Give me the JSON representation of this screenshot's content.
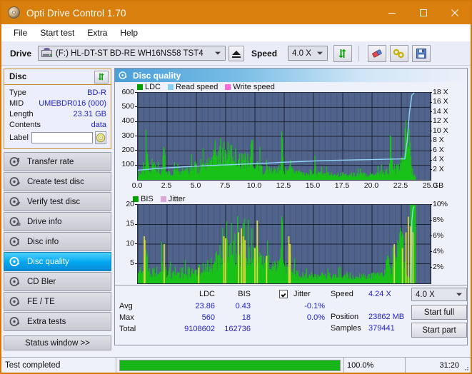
{
  "window": {
    "title": "Opti Drive Control 1.70",
    "icon": "disc-icon",
    "minimize": "minimize-icon",
    "maximize": "maximize-icon",
    "close": "close-icon",
    "accent": "#d97f0d"
  },
  "menu": {
    "items": [
      {
        "label": "File"
      },
      {
        "label": "Start test"
      },
      {
        "label": "Extra"
      },
      {
        "label": "Help"
      }
    ]
  },
  "toolbar": {
    "drive_label": "Drive",
    "drive_value": "(F:)  HL-DT-ST BD-RE  WH16NS58 TST4",
    "eject": "eject-icon",
    "speed_label": "Speed",
    "speed_value": "4.0 X",
    "refresh": "refresh-icon",
    "erase": "eraser-icon",
    "tools": "tools-icon",
    "save": "save-icon"
  },
  "disc_panel": {
    "title": "Disc",
    "refresh": "refresh-icon",
    "rows": [
      {
        "key": "Type",
        "value": "BD-R"
      },
      {
        "key": "MID",
        "value": "UMEBDR016 (000)"
      },
      {
        "key": "Length",
        "value": "23.31 GB"
      },
      {
        "key": "Contents",
        "value": "data"
      }
    ],
    "label_key": "Label",
    "label_value": "",
    "label_placeholder": "",
    "disc_button": "disc-icon"
  },
  "nav": {
    "items": [
      {
        "label": "Transfer rate",
        "icon": "disc-speed-icon",
        "active": false
      },
      {
        "label": "Create test disc",
        "icon": "disc-write-icon",
        "active": false
      },
      {
        "label": "Verify test disc",
        "icon": "disc-verify-icon",
        "active": false
      },
      {
        "label": "Drive info",
        "icon": "drive-info-icon",
        "active": false
      },
      {
        "label": "Disc info",
        "icon": "disc-info-icon",
        "active": false
      },
      {
        "label": "Disc quality",
        "icon": "disc-quality-icon",
        "active": true
      },
      {
        "label": "CD Bler",
        "icon": "disc-bler-icon",
        "active": false
      },
      {
        "label": "FE / TE",
        "icon": "disc-fete-icon",
        "active": false
      },
      {
        "label": "Extra tests",
        "icon": "disc-extra-icon",
        "active": false
      }
    ],
    "status_window": "Status window >>"
  },
  "pane": {
    "title": "Disc quality",
    "icon": "disc-quality-icon"
  },
  "chart_data": [
    {
      "id": "ldc-chart",
      "type": "area",
      "title": "",
      "xlabel": "GB",
      "ylabel": "",
      "xlim": [
        0,
        25
      ],
      "xticks": [
        "0.0",
        "2.5",
        "5.0",
        "7.5",
        "10.0",
        "12.5",
        "15.0",
        "17.5",
        "20.0",
        "22.5",
        "25.0"
      ],
      "xtick_values": [
        0,
        2.5,
        5,
        7.5,
        10,
        12.5,
        15,
        17.5,
        20,
        22.5,
        25
      ],
      "ylim": [
        0,
        600
      ],
      "yticks": [
        "100",
        "200",
        "300",
        "400",
        "500",
        "600"
      ],
      "ytick_values": [
        100,
        200,
        300,
        400,
        500,
        600
      ],
      "y2lim": [
        0,
        18
      ],
      "y2ticks": [
        "2 X",
        "4 X",
        "6 X",
        "8 X",
        "10 X",
        "12 X",
        "14 X",
        "16 X",
        "18 X"
      ],
      "y2tick_values": [
        2,
        4,
        6,
        8,
        10,
        12,
        14,
        16,
        18
      ],
      "grid": true,
      "legend_position": "top-left",
      "legend": [
        {
          "name": "LDC",
          "color": "#00a000"
        },
        {
          "name": "Read speed",
          "color": "#86d2f4"
        },
        {
          "name": "Write speed",
          "color": "#ff66d9"
        }
      ],
      "series": [
        {
          "name": "LDC",
          "color": "#19c219",
          "type": "area",
          "x": [
            0.0,
            0.15,
            0.3,
            0.45,
            0.6,
            0.75,
            0.9,
            1.05,
            1.2,
            1.35,
            1.5,
            1.65,
            1.8,
            1.95,
            2.1,
            2.25,
            2.4,
            2.55,
            2.7,
            2.85,
            3.0,
            3.15,
            3.3,
            3.45,
            3.6,
            3.75,
            3.9,
            4.05,
            4.2,
            4.35,
            4.5,
            4.65,
            4.8,
            4.95,
            5.1,
            5.25,
            5.4,
            5.55,
            5.7,
            5.85,
            6.0,
            6.15,
            6.3,
            6.45,
            6.6,
            6.75,
            6.9,
            7.05,
            7.2,
            7.35,
            7.5,
            7.65,
            7.8,
            7.95,
            8.1,
            8.25,
            8.4,
            8.55,
            8.7,
            8.85,
            9.0,
            9.15,
            9.3,
            9.45,
            9.6,
            9.75,
            9.9,
            10.05,
            10.2,
            10.35,
            10.5,
            10.65,
            10.8,
            10.95,
            11.1,
            11.25,
            11.4,
            11.55,
            11.7,
            11.85,
            12.0,
            12.15,
            12.3,
            12.45,
            12.6,
            12.75,
            12.9,
            13.05,
            13.2,
            13.35,
            13.5,
            13.65,
            13.8,
            13.95,
            14.1,
            14.25,
            14.4,
            14.55,
            14.7,
            14.85,
            15.0,
            15.15,
            15.3,
            15.45,
            15.6,
            15.75,
            15.9,
            16.05,
            16.2,
            16.35,
            16.5,
            16.65,
            16.8,
            16.95,
            17.1,
            17.25,
            17.4,
            17.55,
            17.7,
            17.85,
            18.0,
            18.15,
            18.3,
            18.45,
            18.6,
            18.75,
            18.9,
            19.05,
            19.2,
            19.35,
            19.5,
            19.65,
            19.8,
            19.95,
            20.1,
            20.25,
            20.4,
            20.55,
            20.7,
            20.85,
            21.0,
            21.15,
            21.3,
            21.45,
            21.6,
            21.75,
            21.9,
            22.05,
            22.2,
            22.35,
            22.5,
            22.65,
            22.8,
            22.95,
            23.1,
            23.25,
            23.4,
            23.55,
            23.7
          ],
          "values": [
            55,
            80,
            60,
            160,
            95,
            560,
            120,
            70,
            90,
            160,
            70,
            60,
            100,
            55,
            60,
            450,
            75,
            60,
            90,
            65,
            60,
            180,
            70,
            140,
            60,
            170,
            60,
            100,
            95,
            60,
            130,
            110,
            80,
            190,
            70,
            110,
            95,
            150,
            90,
            170,
            120,
            200,
            155,
            230,
            180,
            260,
            200,
            300,
            250,
            310,
            240,
            290,
            220,
            280,
            250,
            260,
            215,
            240,
            190,
            230,
            185,
            225,
            175,
            200,
            160,
            430,
            150,
            175,
            145,
            170,
            140,
            90,
            95,
            80,
            115,
            90,
            100,
            85,
            105,
            90,
            110,
            95,
            410,
            120,
            90,
            100,
            80,
            220,
            90,
            75,
            85,
            70,
            90,
            65,
            85,
            60,
            80,
            55,
            75,
            60,
            70,
            190,
            65,
            60,
            75,
            55,
            70,
            60,
            65,
            55,
            60,
            50,
            65,
            55,
            60,
            50,
            55,
            60,
            50,
            55,
            45,
            60,
            50,
            55,
            50,
            60,
            45,
            55,
            50,
            60,
            55,
            50,
            60,
            55,
            65,
            60,
            70,
            65,
            75,
            70,
            80,
            75,
            90,
            85,
            430,
            110,
            120,
            100,
            115,
            130,
            150,
            250,
            400,
            510,
            470,
            300,
            60,
            45,
            30
          ]
        },
        {
          "name": "Read speed",
          "color": "#8fd5f7",
          "type": "line",
          "axis": "right",
          "x": [
            0.0,
            1.0,
            2.0,
            3.0,
            4.0,
            5.0,
            6.0,
            7.0,
            8.0,
            9.0,
            10.0,
            11.0,
            12.0,
            13.0,
            14.0,
            15.0,
            16.0,
            17.0,
            18.0,
            19.0,
            20.0,
            21.0,
            22.0,
            22.8,
            23.0,
            23.2,
            23.4,
            23.6
          ],
          "values": [
            2.0,
            2.2,
            2.4,
            2.55,
            2.7,
            2.85,
            2.95,
            3.05,
            3.15,
            3.25,
            3.35,
            3.45,
            3.6,
            3.7,
            3.8,
            3.9,
            4.0,
            4.05,
            4.1,
            4.15,
            4.2,
            4.25,
            4.3,
            4.35,
            8.0,
            14.0,
            17.5,
            18.0
          ]
        }
      ]
    },
    {
      "id": "bis-chart",
      "type": "area",
      "title": "",
      "xlabel": "GB",
      "ylabel": "",
      "xlim": [
        0,
        25
      ],
      "xticks": [
        "0.0",
        "2.5",
        "5.0",
        "7.5",
        "10.0",
        "12.5",
        "15.0",
        "17.5",
        "20.0",
        "22.5",
        "25.0"
      ],
      "xtick_values": [
        0,
        2.5,
        5,
        7.5,
        10,
        12.5,
        15,
        17.5,
        20,
        22.5,
        25
      ],
      "ylim": [
        0,
        20
      ],
      "yticks": [
        "5",
        "10",
        "15",
        "20"
      ],
      "ytick_values": [
        5,
        10,
        15,
        20
      ],
      "y2lim": [
        0,
        10
      ],
      "y2ticks": [
        "2%",
        "4%",
        "6%",
        "8%",
        "10%"
      ],
      "y2tick_values": [
        2,
        4,
        6,
        8,
        10
      ],
      "grid": true,
      "legend_position": "top-left",
      "legend": [
        {
          "name": "BIS",
          "color": "#00a000"
        },
        {
          "name": "Jitter",
          "color": "#d9a8d9"
        }
      ],
      "series": [
        {
          "name": "BIS",
          "color": "#19c219",
          "type": "area",
          "x": [
            0.0,
            0.15,
            0.3,
            0.45,
            0.6,
            0.75,
            0.9,
            1.05,
            1.2,
            1.35,
            1.5,
            1.65,
            1.8,
            1.95,
            2.1,
            2.25,
            2.4,
            2.55,
            2.7,
            2.85,
            3.0,
            3.15,
            3.3,
            3.45,
            3.6,
            3.75,
            3.9,
            4.05,
            4.2,
            4.35,
            4.5,
            4.65,
            4.8,
            4.95,
            5.1,
            5.25,
            5.4,
            5.55,
            5.7,
            5.85,
            6.0,
            6.15,
            6.3,
            6.45,
            6.6,
            6.75,
            6.9,
            7.05,
            7.2,
            7.35,
            7.5,
            7.65,
            7.8,
            7.95,
            8.1,
            8.25,
            8.4,
            8.55,
            8.7,
            8.85,
            9.0,
            9.15,
            9.3,
            9.45,
            9.6,
            9.75,
            9.9,
            10.05,
            10.2,
            10.35,
            10.5,
            10.65,
            10.8,
            10.95,
            11.1,
            11.25,
            11.4,
            11.55,
            11.7,
            11.85,
            12.0,
            12.15,
            12.3,
            12.45,
            12.6,
            12.75,
            12.9,
            13.05,
            13.2,
            13.35,
            13.5,
            13.65,
            13.8,
            13.95,
            14.1,
            14.25,
            14.4,
            14.55,
            14.7,
            14.85,
            15.0,
            15.15,
            15.3,
            15.45,
            15.6,
            15.75,
            15.9,
            16.05,
            16.2,
            16.35,
            16.5,
            16.65,
            16.8,
            16.95,
            17.1,
            17.25,
            17.4,
            17.55,
            17.7,
            17.85,
            18.0,
            18.15,
            18.3,
            18.45,
            18.6,
            18.75,
            18.9,
            19.05,
            19.2,
            19.35,
            19.5,
            19.65,
            19.8,
            19.95,
            20.1,
            20.25,
            20.4,
            20.55,
            20.7,
            20.85,
            21.0,
            21.15,
            21.3,
            21.45,
            21.6,
            21.75,
            21.9,
            22.05,
            22.2,
            22.35,
            22.5,
            22.65,
            22.8,
            22.95,
            23.1,
            23.25,
            23.4,
            23.55,
            23.7
          ],
          "values": [
            5.5,
            4.5,
            5.5,
            4.0,
            12.0,
            11.0,
            4.0,
            5.0,
            3.5,
            4.5,
            3.0,
            5.0,
            3.5,
            4.0,
            10.0,
            3.5,
            5.0,
            3.0,
            4.5,
            3.0,
            4.0,
            5.0,
            3.5,
            4.0,
            3.0,
            5.0,
            3.5,
            4.0,
            3.0,
            5.5,
            3.5,
            4.0,
            3.0,
            5.0,
            3.5,
            6.0,
            4.0,
            7.0,
            5.0,
            8.0,
            6.0,
            7.5,
            6.5,
            8.0,
            7.0,
            9.0,
            7.5,
            12.0,
            9.0,
            11.0,
            8.5,
            12.0,
            9.5,
            11.0,
            9.0,
            14.0,
            10.0,
            12.0,
            9.5,
            13.0,
            10.0,
            11.5,
            9.0,
            11.0,
            9.5,
            16.0,
            10.0,
            11.5,
            9.0,
            10.0,
            8.5,
            9.0,
            7.5,
            8.5,
            7.0,
            8.0,
            6.5,
            7.5,
            6.0,
            7.0,
            5.5,
            6.5,
            12.0,
            8.0,
            6.0,
            5.0,
            4.5,
            5.0,
            4.0,
            4.5,
            3.5,
            4.0,
            3.0,
            3.5,
            3.0,
            3.5,
            2.5,
            3.0,
            2.5,
            3.0,
            2.5,
            3.0,
            2.5,
            3.0,
            2.5,
            3.0,
            2.5,
            3.0,
            2.5,
            3.0,
            2.5,
            3.0,
            2.5,
            3.0,
            2.5,
            3.0,
            2.5,
            3.0,
            2.5,
            3.0,
            2.5,
            3.0,
            2.5,
            3.0,
            2.5,
            3.0,
            2.5,
            3.0,
            2.5,
            3.0,
            2.5,
            3.0,
            2.5,
            3.0,
            3.0,
            3.5,
            3.0,
            3.5,
            3.0,
            3.5,
            3.0,
            4.0,
            9.5,
            6.5,
            5.5,
            6.0,
            7.0,
            9.0,
            13.0,
            14.0,
            17.0,
            14.0,
            4.0,
            2.5,
            2.0
          ]
        },
        {
          "name": "Jitter",
          "color": "#d9d93a",
          "type": "spikes",
          "x": [
            0.55,
            0.6,
            2.25,
            5.2,
            7.35,
            7.5,
            8.6,
            8.85,
            9.0,
            9.15,
            10.0,
            10.2,
            11.0,
            12.9,
            13.0,
            21.9,
            22.6,
            22.9,
            23.1,
            23.3,
            23.5
          ],
          "values": [
            12.0,
            11.0,
            10.0,
            4.0,
            12.0,
            11.5,
            13.0,
            14.0,
            12.0,
            11.0,
            9.0,
            16.0,
            7.0,
            12.0,
            10.0,
            10.0,
            9.0,
            13.0,
            17.0,
            14.5,
            13.0
          ]
        },
        {
          "name": "Read speed",
          "color": "#8fd5f7",
          "type": "line",
          "axis": "right",
          "x": [
            23.35,
            23.4,
            23.5,
            23.6
          ],
          "values": [
            0.0,
            8.0,
            9.5,
            9.8
          ]
        }
      ]
    }
  ],
  "stats": {
    "col_ldc": "LDC",
    "col_bis": "BIS",
    "jitter_label": "Jitter",
    "jitter_checked": true,
    "rows": [
      {
        "name": "Avg",
        "ldc": "23.86",
        "bis": "0.43",
        "jitter": "-0.1%"
      },
      {
        "name": "Max",
        "ldc": "560",
        "bis": "18",
        "jitter": "0.0%"
      },
      {
        "name": "Total",
        "ldc": "9108602",
        "bis": "162736",
        "jitter": ""
      }
    ],
    "speed_label": "Speed",
    "speed_value": "4.24 X",
    "position_label": "Position",
    "position_value": "23862 MB",
    "samples_label": "Samples",
    "samples_value": "379441",
    "speed_select": "4.0 X",
    "start_full": "Start full",
    "start_part": "Start part"
  },
  "statusbar": {
    "message": "Test completed",
    "progress_percent": 100.0,
    "progress_text": "100.0%",
    "elapsed": "31:20",
    "progress_color": "#16b616"
  }
}
